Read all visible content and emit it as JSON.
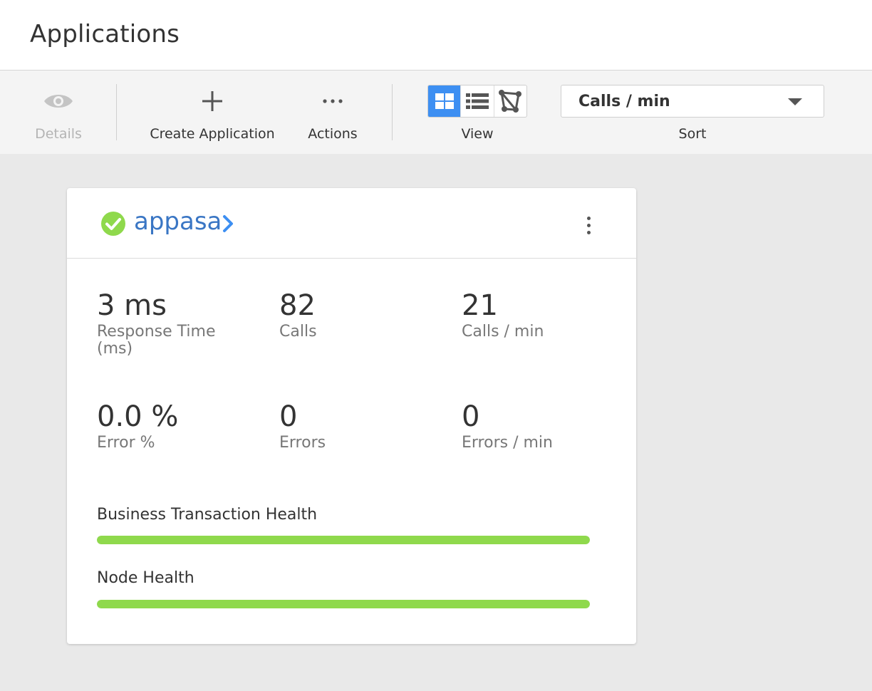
{
  "header": {
    "title": "Applications"
  },
  "toolbar": {
    "details": {
      "label": "Details",
      "icon": "eye-icon"
    },
    "create": {
      "label": "Create Application",
      "icon": "plus-icon"
    },
    "actions": {
      "label": "Actions",
      "icon": "ellipsis-icon"
    },
    "view": {
      "label": "View",
      "options": [
        {
          "icon": "grid-view-icon",
          "active": true
        },
        {
          "icon": "list-view-icon",
          "active": false
        },
        {
          "icon": "flow-map-icon",
          "active": false
        }
      ]
    },
    "sort": {
      "label": "Sort",
      "selected": "Calls / min"
    }
  },
  "app_card": {
    "name": "appasa",
    "status": "healthy",
    "status_color": "#8fd94c",
    "metrics": [
      {
        "value": "3 ms",
        "label": "Response Time (ms)"
      },
      {
        "value": "82",
        "label": "Calls"
      },
      {
        "value": "21",
        "label": "Calls / min"
      },
      {
        "value": "0.0 %",
        "label": "Error %"
      },
      {
        "value": "0",
        "label": "Errors"
      },
      {
        "value": "0",
        "label": "Errors / min"
      }
    ],
    "health": [
      {
        "label": "Business Transaction Health",
        "fraction": 1.0,
        "color": "#8fd94c"
      },
      {
        "label": "Node Health",
        "fraction": 1.0,
        "color": "#8fd94c"
      }
    ]
  },
  "colors": {
    "accent": "#3d8ff2",
    "link": "#3a76c4",
    "healthy": "#8fd94c"
  }
}
